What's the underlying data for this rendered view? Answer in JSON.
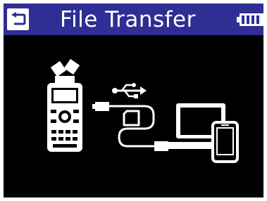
{
  "header": {
    "title": "File Transfer",
    "back_icon": "back-arrow-icon",
    "battery_icon": "battery-icon"
  },
  "illustration": {
    "device_icon": "recorder-icon",
    "usb_icon": "usb-symbol-icon",
    "cable_icon": "usb-cable-icon",
    "card_icon": "sd-card-icon",
    "computer_icon": "laptop-icon",
    "phone_icon": "smartphone-icon"
  },
  "colors": {
    "title_bar": "#2e2e94",
    "screen_background": "#000000",
    "foreground": "#ffffff"
  }
}
